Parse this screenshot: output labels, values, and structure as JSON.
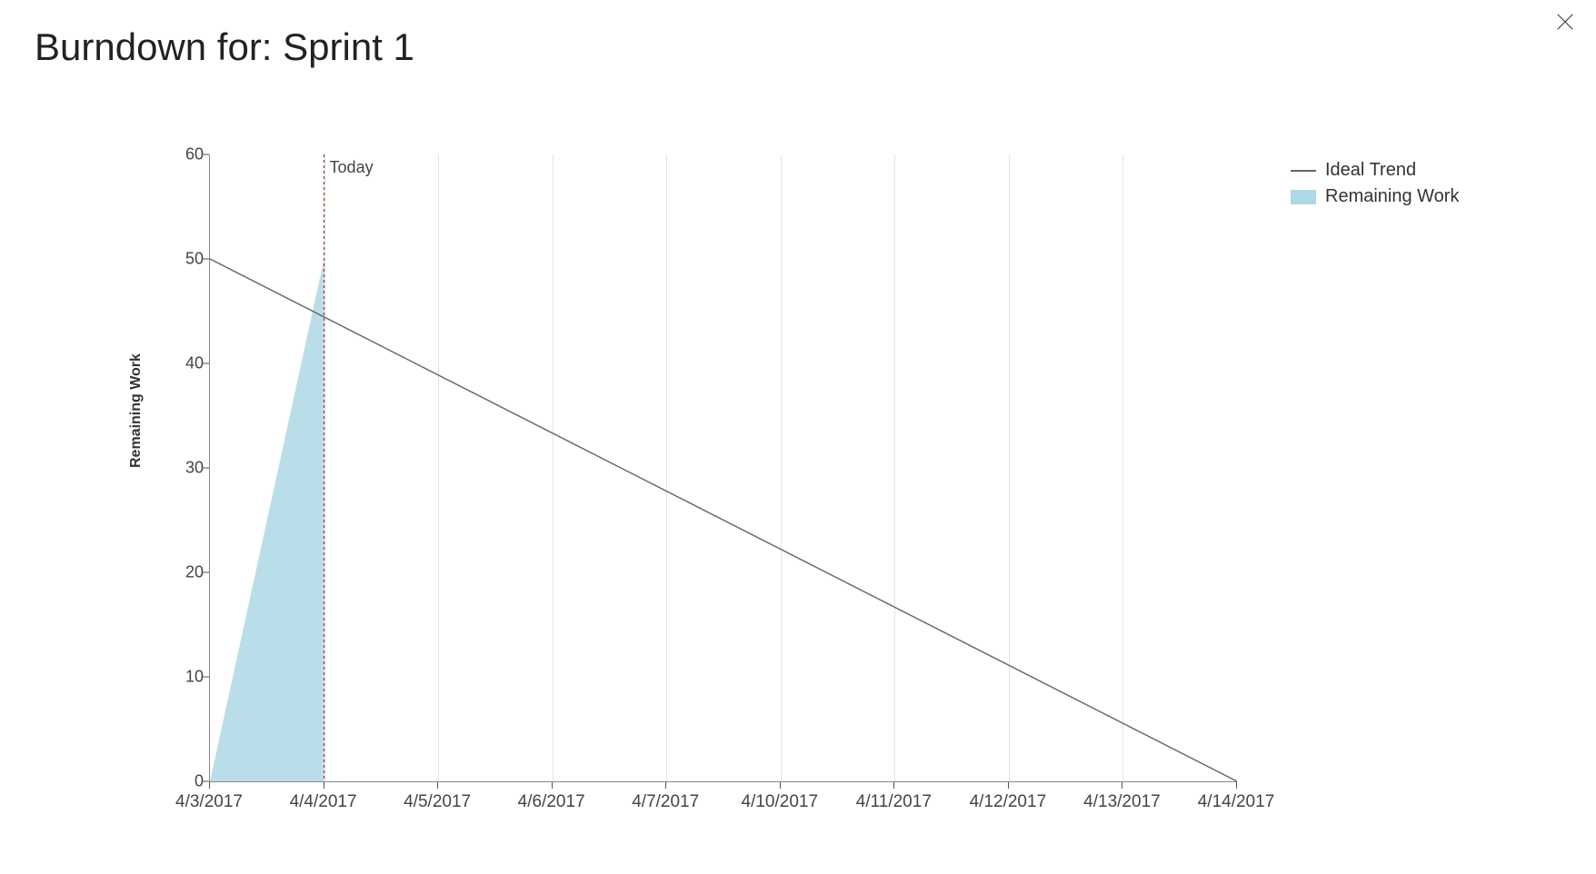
{
  "title": "Burndown for: Sprint 1",
  "legend": {
    "ideal": "Ideal Trend",
    "remaining": "Remaining Work"
  },
  "axes": {
    "ylabel": "Remaining Work",
    "today_label": "Today"
  },
  "chart_data": {
    "type": "area",
    "xlabel": "",
    "ylabel": "Remaining Work",
    "ylim": [
      0,
      60
    ],
    "y_ticks": [
      0,
      10,
      20,
      30,
      40,
      50,
      60
    ],
    "categories": [
      "4/3/2017",
      "4/4/2017",
      "4/5/2017",
      "4/6/2017",
      "4/7/2017",
      "4/10/2017",
      "4/11/2017",
      "4/12/2017",
      "4/13/2017",
      "4/14/2017"
    ],
    "today_index": 1,
    "series": [
      {
        "name": "Ideal Trend",
        "type": "line",
        "values": [
          50,
          44.4,
          38.9,
          33.3,
          27.8,
          22.2,
          16.7,
          11.1,
          5.6,
          0
        ]
      },
      {
        "name": "Remaining Work",
        "type": "area",
        "values": [
          0,
          50,
          null,
          null,
          null,
          null,
          null,
          null,
          null,
          null
        ]
      }
    ]
  }
}
